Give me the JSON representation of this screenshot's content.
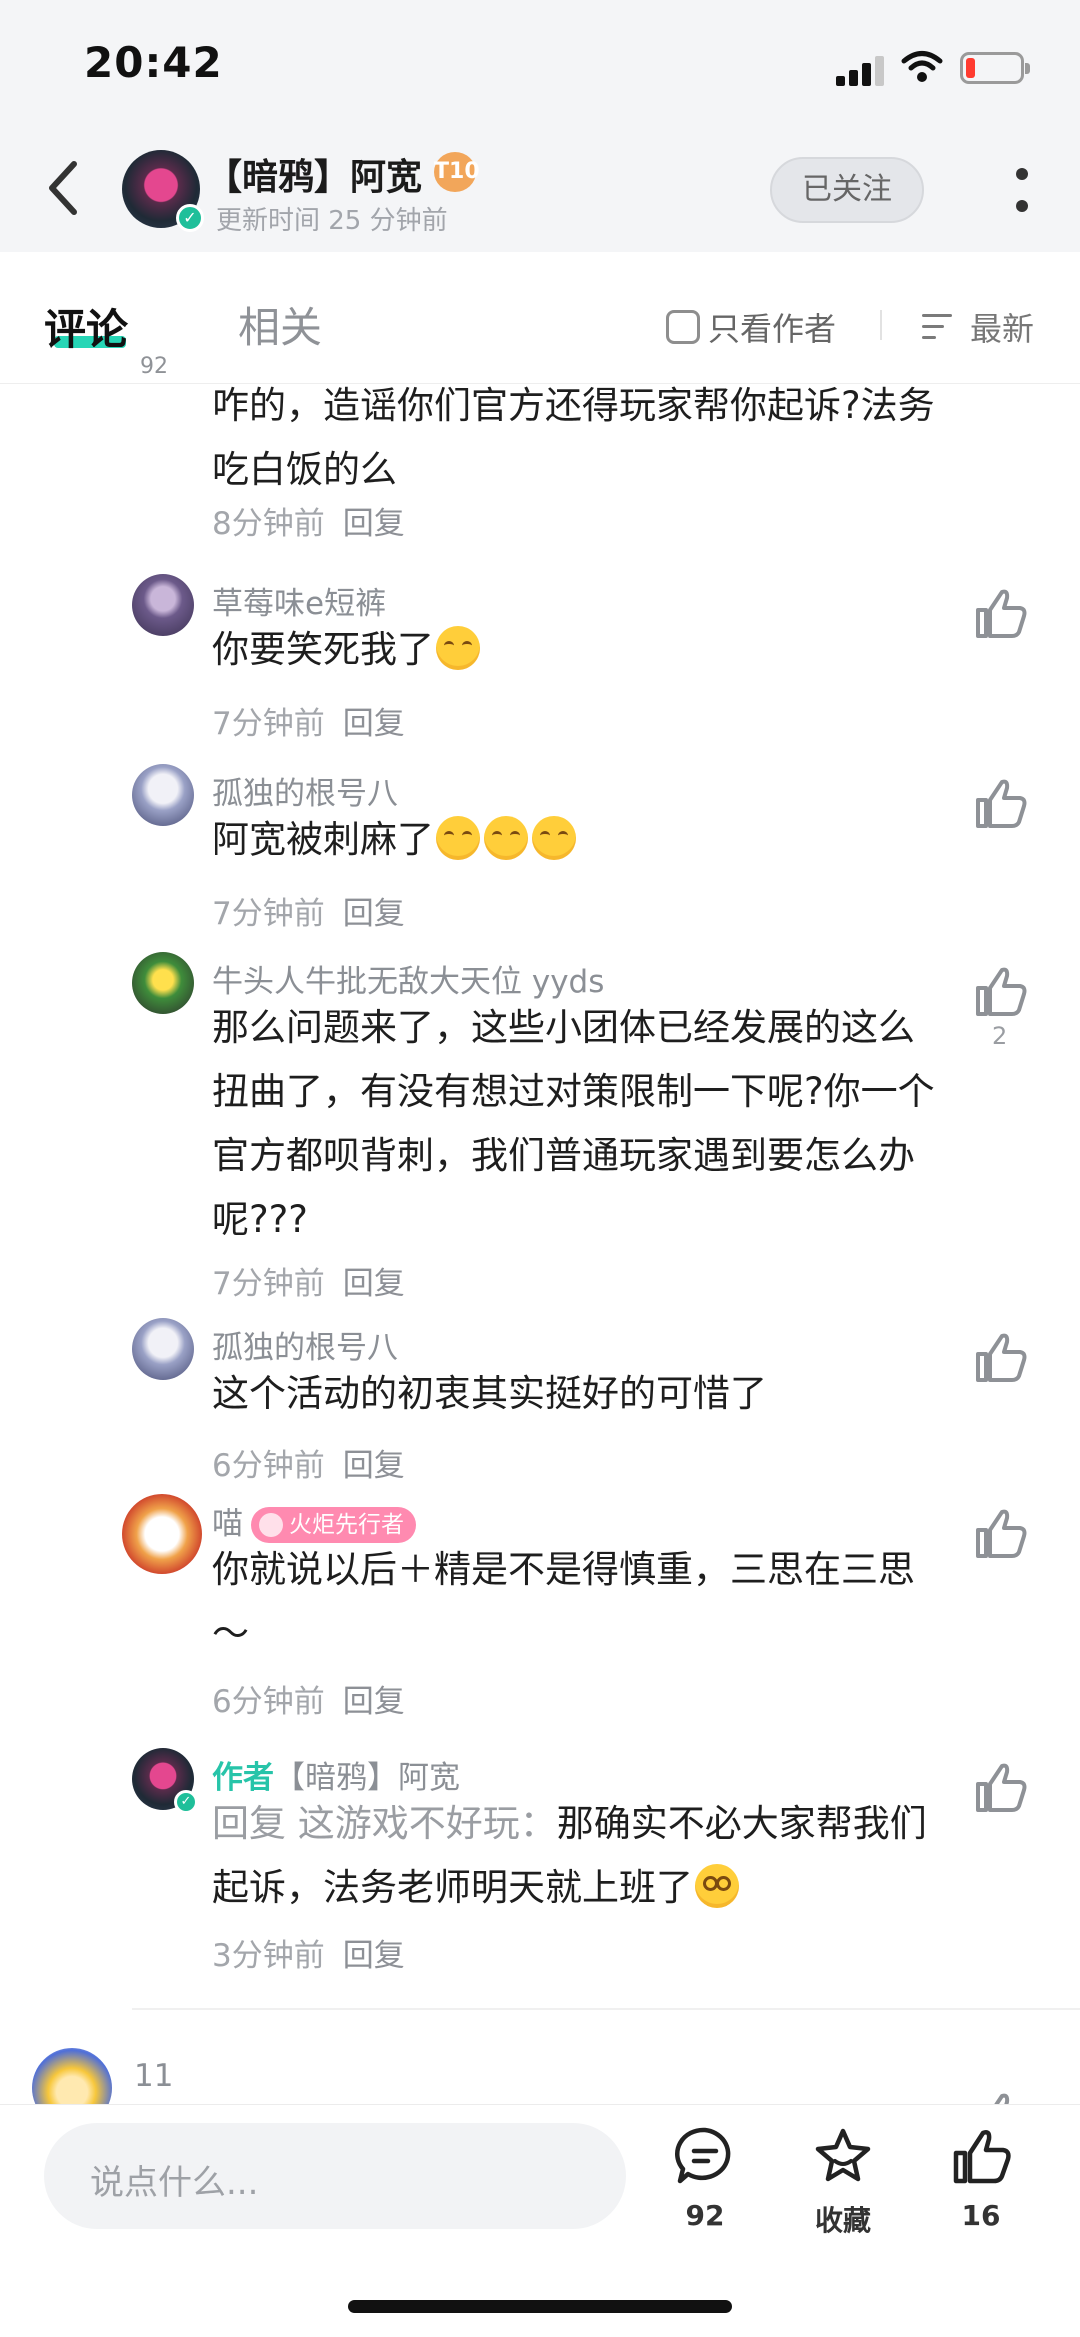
{
  "status_bar": {
    "time": "20:42"
  },
  "header": {
    "author_name": "【暗鸦】阿宽",
    "level_badge": "T10",
    "update_time": "更新时间 25 分钟前",
    "follow_label": "已关注"
  },
  "tabs": {
    "comments_label": "评论",
    "comments_count": "92",
    "related_label": "相关",
    "author_only_label": "只看作者",
    "sort_label": "最新"
  },
  "comments": [
    {
      "name": "",
      "text": "咋的，造谣你们官方还得玩家帮你起诉?法务吃白饭的么",
      "time": "8分钟前",
      "reply": "回复",
      "likes": ""
    },
    {
      "name": "草莓味e短裤",
      "text": "你要笑死我了",
      "time": "7分钟前",
      "reply": "回复",
      "likes": ""
    },
    {
      "name": "孤独的根号八",
      "text": "阿宽被刺麻了",
      "time": "7分钟前",
      "reply": "回复",
      "likes": ""
    },
    {
      "name": "牛头人牛批无敌大天位 yyds",
      "text": "那么问题来了，这些小团体已经发展的这么扭曲了，有没有想过对策限制一下呢?你一个官方都呗背刺，我们普通玩家遇到要怎么办呢???",
      "time": "7分钟前",
      "reply": "回复",
      "likes": "2"
    },
    {
      "name": "孤独的根号八",
      "text": "这个活动的初衷其实挺好的可惜了",
      "time": "6分钟前",
      "reply": "回复",
      "likes": ""
    },
    {
      "name": "喵",
      "badge": "火炬先行者",
      "text": "你就说以后＋精是不是得慎重，三思在三思～",
      "time": "6分钟前",
      "reply": "回复",
      "likes": ""
    },
    {
      "author_tag": "作者",
      "name": "【暗鸦】阿宽",
      "reply_prefix": "回复 这游戏不好玩：",
      "text": "那确实不必大家帮我们起诉，法务老师明天就上班了",
      "time": "3分钟前",
      "reply": "回复",
      "likes": ""
    },
    {
      "name": "11",
      "text": "",
      "time": "",
      "reply": "",
      "likes": ""
    }
  ],
  "bottom_bar": {
    "input_placeholder": "说点什么...",
    "comment_count": "92",
    "favorite_label": "收藏",
    "like_count": "16"
  },
  "colors": {
    "accent": "#27d6b6",
    "author_green": "#27c4a9",
    "badge_pink": "#ff8ab0"
  },
  "icons": [
    "back-icon",
    "verified-icon",
    "checkbox-icon",
    "sort-icon",
    "like-icon",
    "comment-icon",
    "star-icon"
  ]
}
